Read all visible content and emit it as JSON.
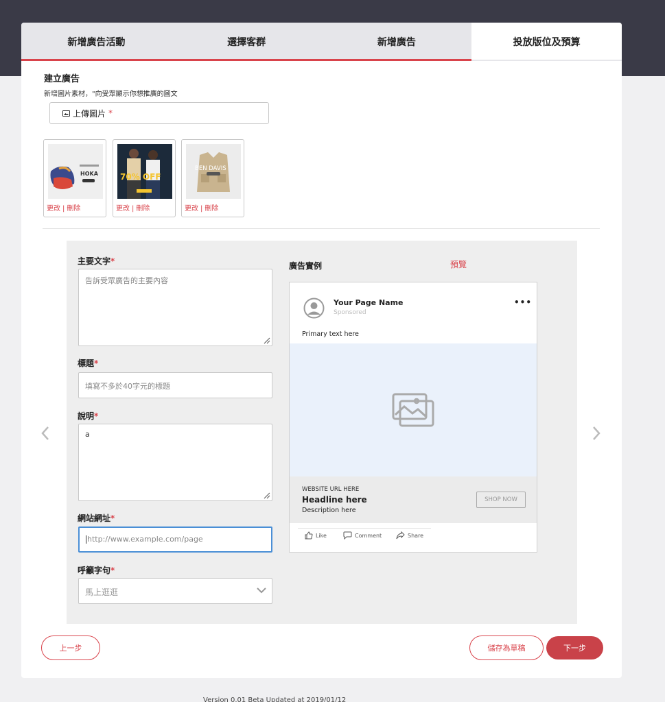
{
  "tabs": [
    "新增廣告活動",
    "選擇客群",
    "新增廣告",
    "投放版位及預算"
  ],
  "section": {
    "title": "建立廣告",
    "subtitle": "新增圖片素材，\"向受眾顯示你想推廣的圖文"
  },
  "upload": {
    "label": "上傳圖片",
    "required_mark": "*"
  },
  "thumbnails": [
    {
      "edit": "更改",
      "sep": "|",
      "delete": "刪除",
      "image_text": "HOKA"
    },
    {
      "edit": "更改",
      "sep": "|",
      "delete": "刪除",
      "image_text": "70% OFF"
    },
    {
      "edit": "更改",
      "sep": "|",
      "delete": "刪除",
      "image_text": "BEN DAVIS"
    }
  ],
  "form": {
    "primary_text": {
      "label": "主要文字",
      "required_mark": "*",
      "placeholder": "告訴受眾廣告的主要內容"
    },
    "headline": {
      "label": "標題",
      "required_mark": "*",
      "placeholder": "填寫不多於40字元的標題"
    },
    "description": {
      "label": "說明",
      "required_mark": "*",
      "value": "a"
    },
    "website": {
      "label": "網站網址",
      "required_mark": "*",
      "placeholder": "http://www.example.com/page"
    },
    "cta": {
      "label": "呼籲字句",
      "required_mark": "*",
      "value": "馬上逛逛"
    }
  },
  "preview": {
    "title": "廣告實例",
    "link": "預覽",
    "page_name": "Your Page Name",
    "sponsored": "Sponsored",
    "more": "•••",
    "primary_text": "Primary text here",
    "url": "WEBSITE URL HERE",
    "headline": "Headline here",
    "description": "Description here",
    "shop_now": "SHOP NOW",
    "like": "Like",
    "comment": "Comment",
    "share": "Share"
  },
  "buttons": {
    "prev": "上一步",
    "save_draft": "儲存為草稿",
    "next": "下一步"
  },
  "footer": {
    "version": "Version 0.01 Beta Updated at 2019/01/12"
  },
  "colors": {
    "accent": "#d9434b",
    "topbar": "#3a3a47",
    "focus": "#4a8fd6"
  }
}
